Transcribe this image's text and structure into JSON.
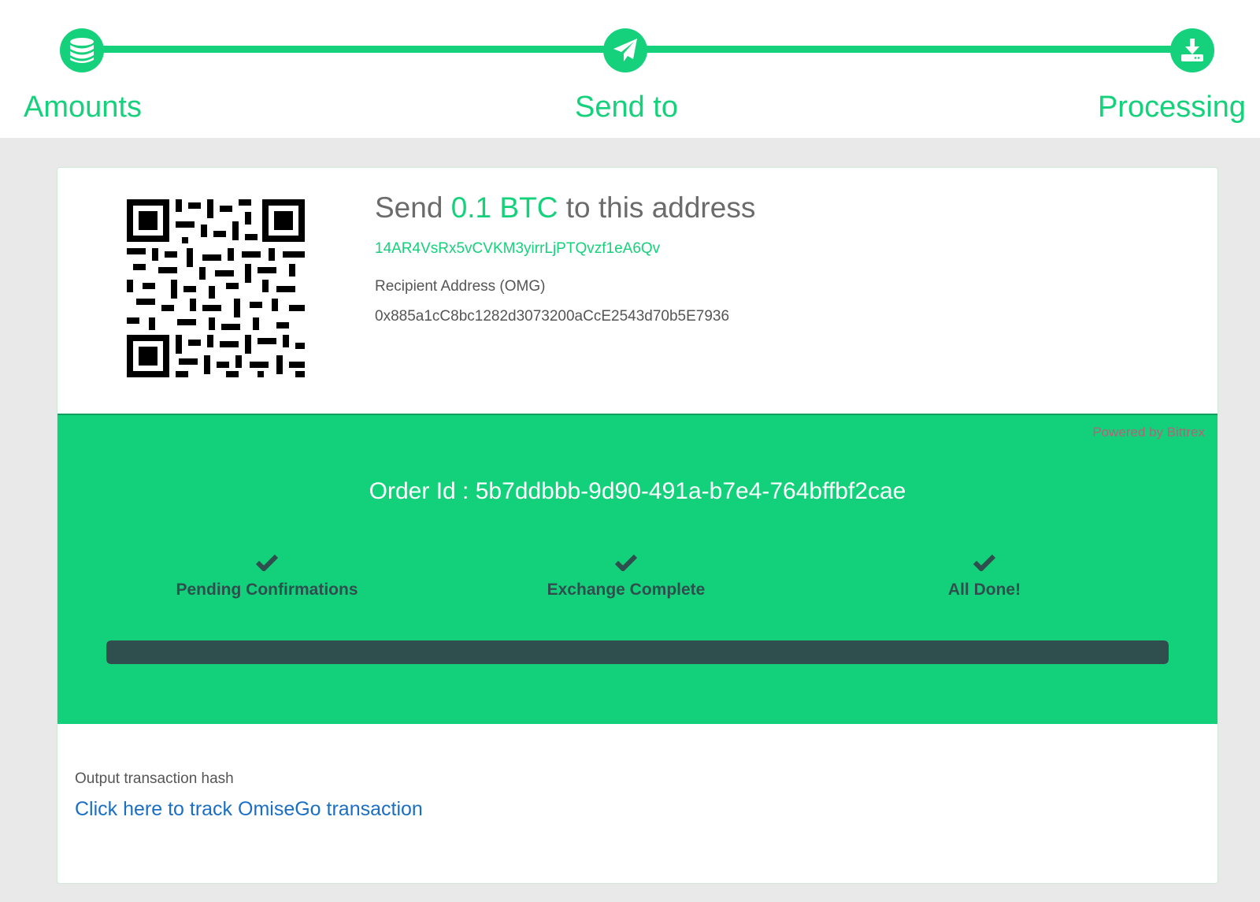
{
  "steps": [
    {
      "label": "Amounts",
      "icon": "database-icon"
    },
    {
      "label": "Send to",
      "icon": "paper-plane-icon"
    },
    {
      "label": "Processing",
      "icon": "download-drive-icon"
    }
  ],
  "send": {
    "prefix": "Send ",
    "amount": "0.1 BTC",
    "suffix": " to this address",
    "btc_address": "14AR4VsRx5vCVKM3yirrLjPTQvzf1eA6Qv",
    "recipient_label": "Recipient Address (OMG)",
    "recipient_address": "0x885a1cC8bc1282d3073200aCcE2543d70b5E7936"
  },
  "status": {
    "powered_by": "Powered by Bittrex",
    "order_id": "Order Id : 5b7ddbbb-9d90-491a-b7e4-764bffbf2cae",
    "stages": [
      {
        "label": "Pending Confirmations",
        "icon": "check-icon"
      },
      {
        "label": "Exchange Complete",
        "icon": "check-icon"
      },
      {
        "label": "All Done!",
        "icon": "check-icon"
      }
    ],
    "progress_percent": 100
  },
  "output": {
    "hash_label": "Output transaction hash",
    "track_link": "Click here to track OmiseGo transaction"
  },
  "colors": {
    "accent": "#16d17b",
    "panel": "#13d17a",
    "dark": "#2f4f4f",
    "link": "#1a6fc4"
  }
}
